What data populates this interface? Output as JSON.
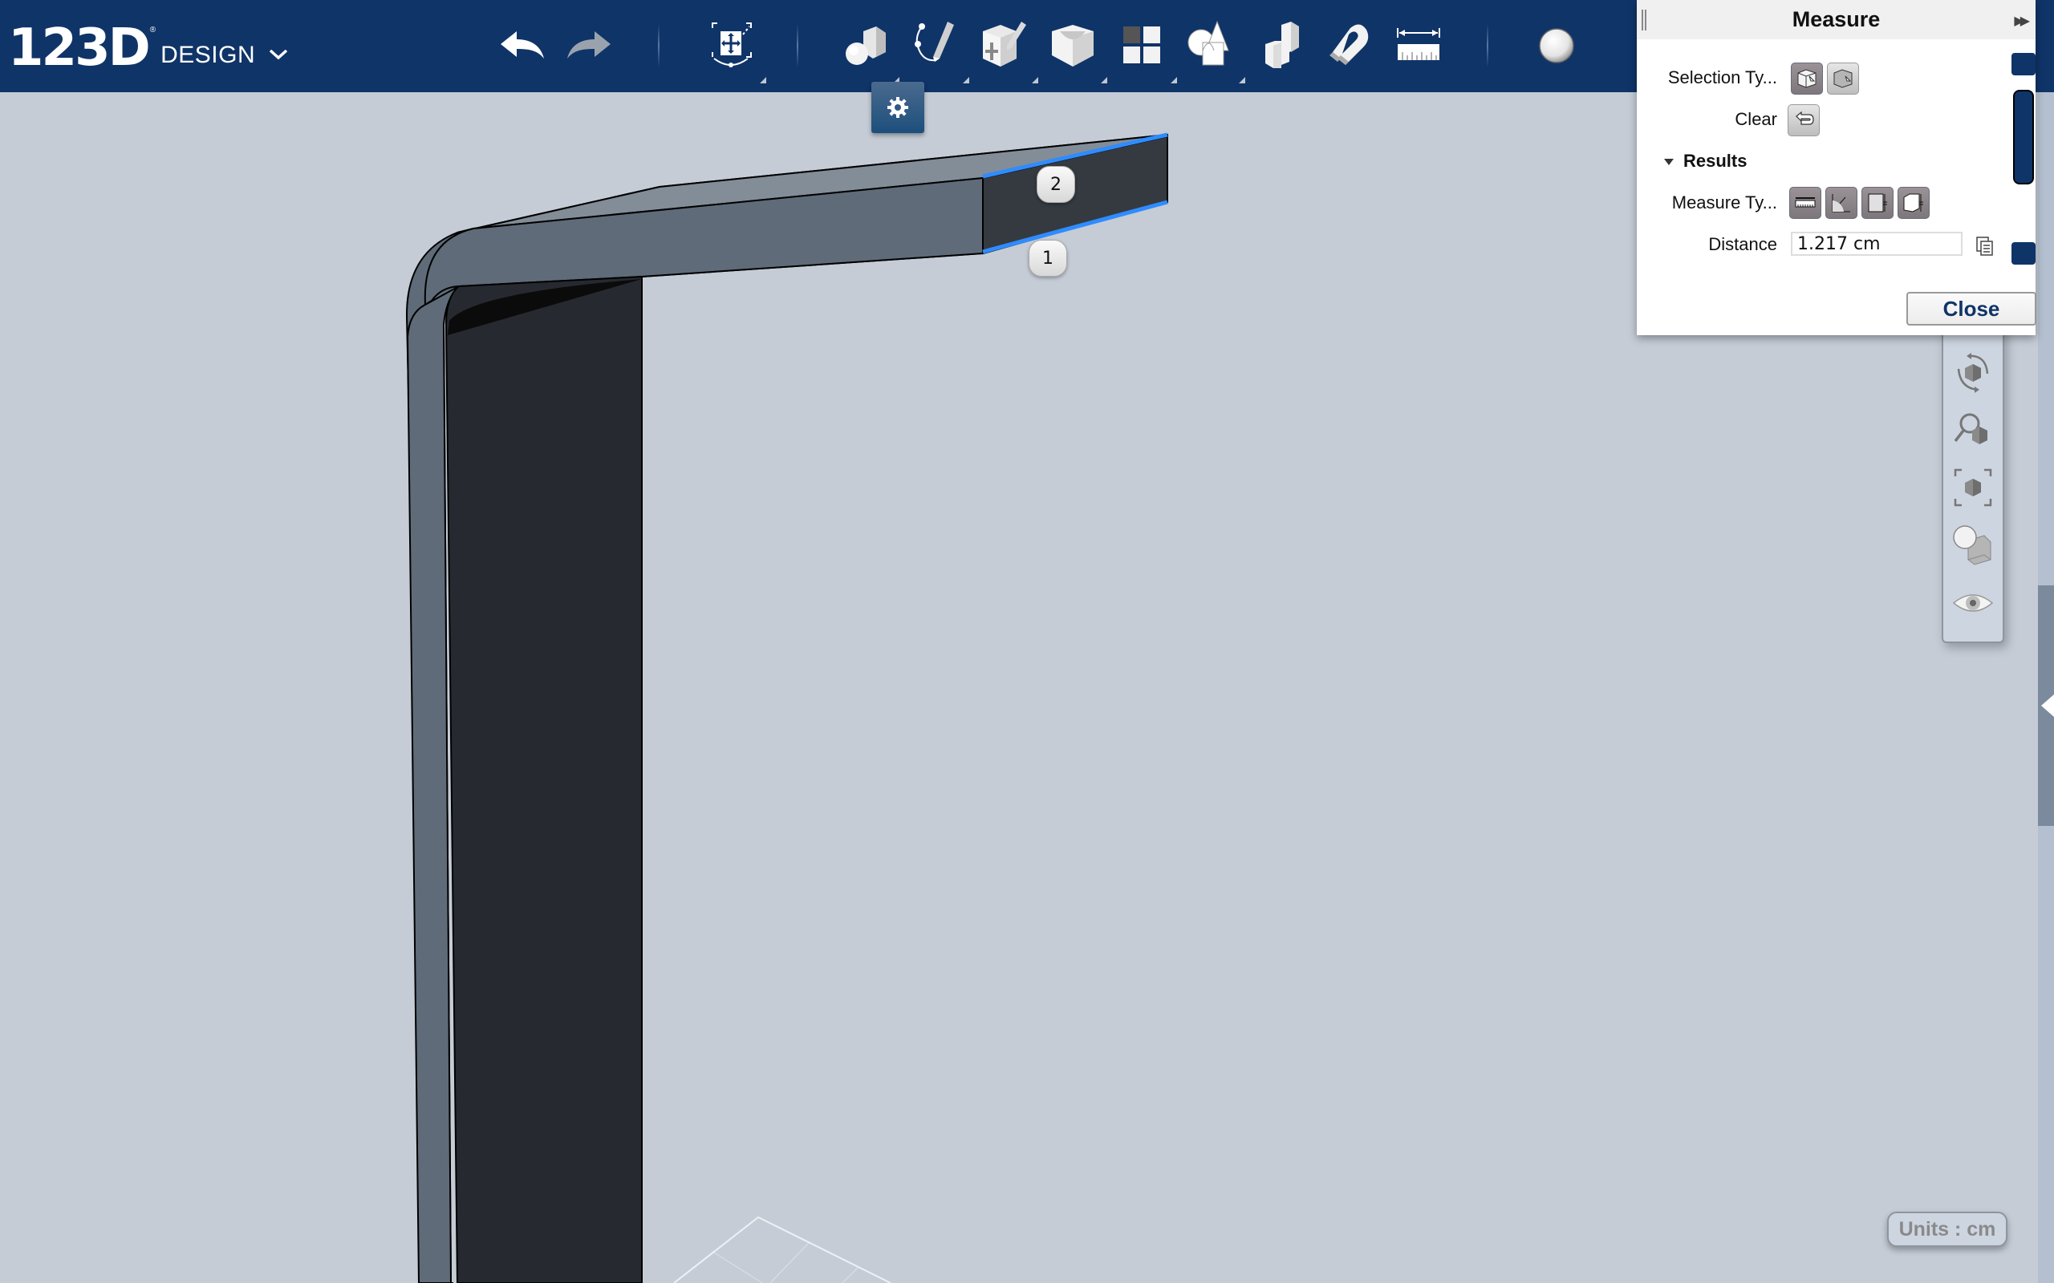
{
  "app": {
    "logo_mark": "123D",
    "logo_reg": "®",
    "logo_word": "DESIGN",
    "logo_menu_icon": "chevron-down-icon",
    "brand_color": "#0f3468"
  },
  "toolbar": {
    "buttons": [
      {
        "id": "undo",
        "icon": "undo-icon",
        "enabled": true
      },
      {
        "id": "redo",
        "icon": "redo-icon",
        "enabled": false
      },
      {
        "id": "transform",
        "icon": "transform-icon",
        "has_menu": true
      },
      {
        "id": "primitives",
        "icon": "primitives-icon",
        "has_menu": true
      },
      {
        "id": "sketch",
        "icon": "sketch-icon",
        "has_menu": true
      },
      {
        "id": "construct",
        "icon": "construct-icon",
        "has_menu": true
      },
      {
        "id": "modify",
        "icon": "modify-icon",
        "has_menu": true
      },
      {
        "id": "pattern",
        "icon": "pattern-icon",
        "has_menu": true
      },
      {
        "id": "combine",
        "icon": "combine-icon",
        "has_menu": true
      },
      {
        "id": "grouping",
        "icon": "grouping-icon",
        "has_menu": false
      },
      {
        "id": "snap",
        "icon": "magnet-icon",
        "has_menu": false
      },
      {
        "id": "measure",
        "icon": "measure-ruler-icon",
        "has_menu": false
      },
      {
        "id": "material",
        "icon": "material-sphere-icon",
        "has_menu": false
      }
    ],
    "settings_popup_icon": "gear-icon"
  },
  "viewport": {
    "markers": [
      "1",
      "2"
    ],
    "selection_color": "#2f8cff",
    "units_label": "Units : cm"
  },
  "nav_bar": {
    "items": [
      {
        "id": "orbit",
        "icon": "orbit-icon"
      },
      {
        "id": "zoom",
        "icon": "zoom-icon"
      },
      {
        "id": "fit",
        "icon": "fit-view-icon"
      },
      {
        "id": "materials-outlines",
        "icon": "material-shading-icon"
      },
      {
        "id": "visibility",
        "icon": "eye-icon"
      }
    ]
  },
  "measure_panel": {
    "title": "Measure",
    "selection_type_label": "Selection Ty...",
    "clear_label": "Clear",
    "results_label": "Results",
    "measure_type_label": "Measure Ty...",
    "distance_label": "Distance",
    "distance_value": "1.217 cm",
    "close_label": "Close"
  }
}
